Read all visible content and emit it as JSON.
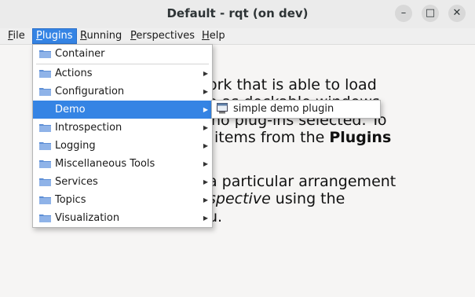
{
  "window": {
    "title": "Default - rqt (on dev)",
    "controls": {
      "minimize": "–",
      "maximize": "□",
      "close": "✕"
    }
  },
  "menubar": {
    "items": [
      {
        "label": "File",
        "mnemonic": "F",
        "rest": "ile"
      },
      {
        "label": "Plugins",
        "mnemonic": "P",
        "rest": "lugins",
        "active": true
      },
      {
        "label": "Running",
        "mnemonic": "R",
        "rest": "unning"
      },
      {
        "label": "Perspectives",
        "mnemonic": "P",
        "rest": "erspectives"
      },
      {
        "label": "Help",
        "mnemonic": "H",
        "rest": "elp"
      }
    ]
  },
  "plugins_menu": {
    "items": [
      {
        "label": "Container",
        "submenu": false
      },
      {
        "label": "Actions",
        "submenu": true
      },
      {
        "label": "Configuration",
        "submenu": true
      },
      {
        "label": "Demo",
        "submenu": true,
        "active": true
      },
      {
        "label": "Introspection",
        "submenu": true
      },
      {
        "label": "Logging",
        "submenu": true
      },
      {
        "label": "Miscellaneous Tools",
        "submenu": true
      },
      {
        "label": "Services",
        "submenu": true
      },
      {
        "label": "Topics",
        "submenu": true
      },
      {
        "label": "Visualization",
        "submenu": true
      }
    ],
    "submenu_arrow": "▶"
  },
  "demo_submenu": {
    "items": [
      {
        "label": "simple demo plugin",
        "icon": "plugin-window-icon"
      }
    ]
  },
  "content": {
    "line1": "ork that is able to load",
    "line2": "e as dockable windows",
    "line3": "no plug-ins selected. To",
    "line4a": "items from the ",
    "line4b": "Plugins",
    "line5": "a particular arrangement",
    "line6a": "spective",
    "line6b": " using the",
    "line7": "u."
  },
  "colors": {
    "accent": "#3584e4",
    "folder": "#5e8fd6"
  }
}
